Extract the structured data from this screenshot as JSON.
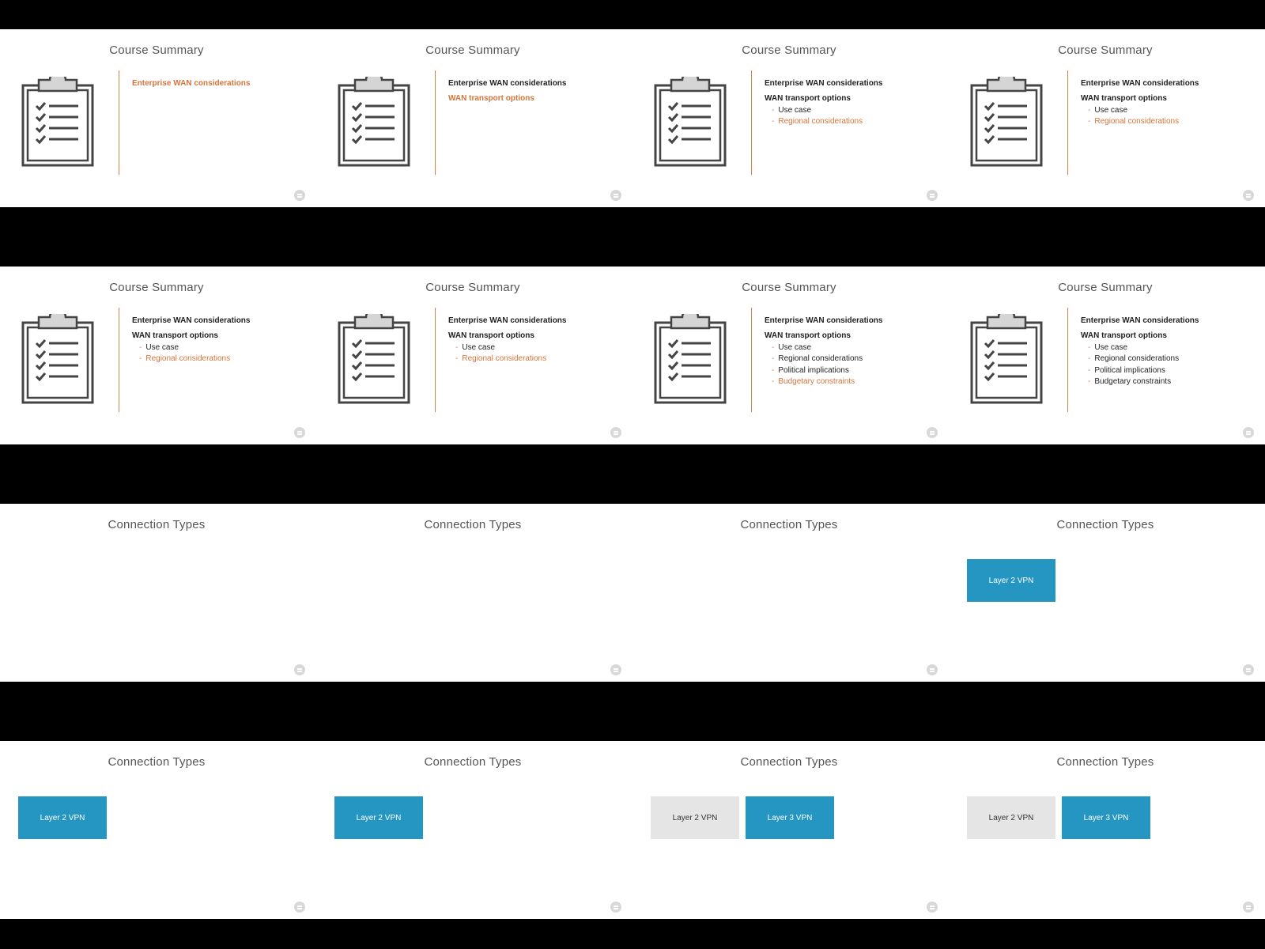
{
  "summary": {
    "title": "Course Summary",
    "items": {
      "enterprise": "Enterprise WAN considerations",
      "transport": "WAN transport options",
      "use_case": "Use case",
      "regional": "Regional considerations",
      "political": "Political implications",
      "budgetary": "Budgetary constraints"
    }
  },
  "connection": {
    "title": "Connection Types",
    "layer2": "Layer 2 VPN",
    "layer3": "Layer 3 VPN"
  },
  "colors": {
    "accent_orange": "#d4753c",
    "vpn_blue": "#2595c2",
    "vpn_gray": "#e5e5e5"
  },
  "grid": {
    "rows": 4,
    "columns": 4
  }
}
